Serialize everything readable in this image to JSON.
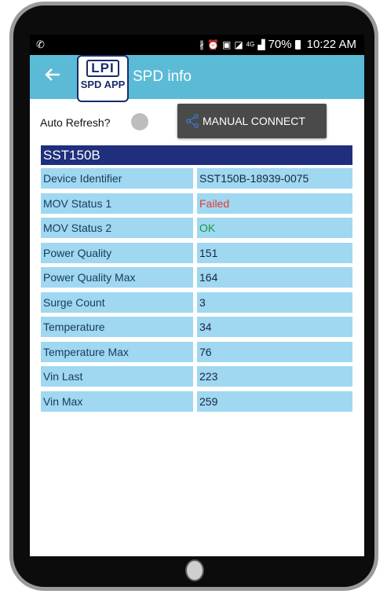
{
  "status_bar": {
    "left_icon": "whatsapp-icon",
    "icons": [
      "bluetooth-icon",
      "alarm-icon",
      "nfc-icon",
      "gallery-icon",
      "4g-icon",
      "signal-icon"
    ],
    "network": "4G",
    "battery": "70%",
    "time": "10:22 AM"
  },
  "app_bar": {
    "back_icon": "back-arrow-icon",
    "logo_line1": "LPI",
    "logo_line2": "SPD APP",
    "title": "SPD info",
    "color": "#5bbbd6"
  },
  "controls": {
    "auto_refresh_label": "Auto Refresh?",
    "auto_refresh_on": false,
    "connect_button_label": "MANUAL CONNECT",
    "connect_icon": "share-icon"
  },
  "device": {
    "name": "SST150B",
    "rows": [
      {
        "label": "Device Identifier",
        "value": "SST150B-18939-0075",
        "status": ""
      },
      {
        "label": "MOV Status 1",
        "value": "Failed",
        "status": "failed"
      },
      {
        "label": "MOV Status 2",
        "value": "OK",
        "status": "ok"
      },
      {
        "label": "Power Quality",
        "value": "151",
        "status": ""
      },
      {
        "label": "Power Quality Max",
        "value": "164",
        "status": ""
      },
      {
        "label": "Surge Count",
        "value": "3",
        "status": ""
      },
      {
        "label": "Temperature",
        "value": "34",
        "status": ""
      },
      {
        "label": "Temperature Max",
        "value": "76",
        "status": ""
      },
      {
        "label": "Vin Last",
        "value": "223",
        "status": ""
      },
      {
        "label": "Vin Max",
        "value": "259",
        "status": ""
      }
    ]
  },
  "colors": {
    "header_navy": "#1f2f7d",
    "cell_blue": "#9fd8f0",
    "failed_red": "#e53935",
    "ok_green": "#1a9a3a"
  }
}
